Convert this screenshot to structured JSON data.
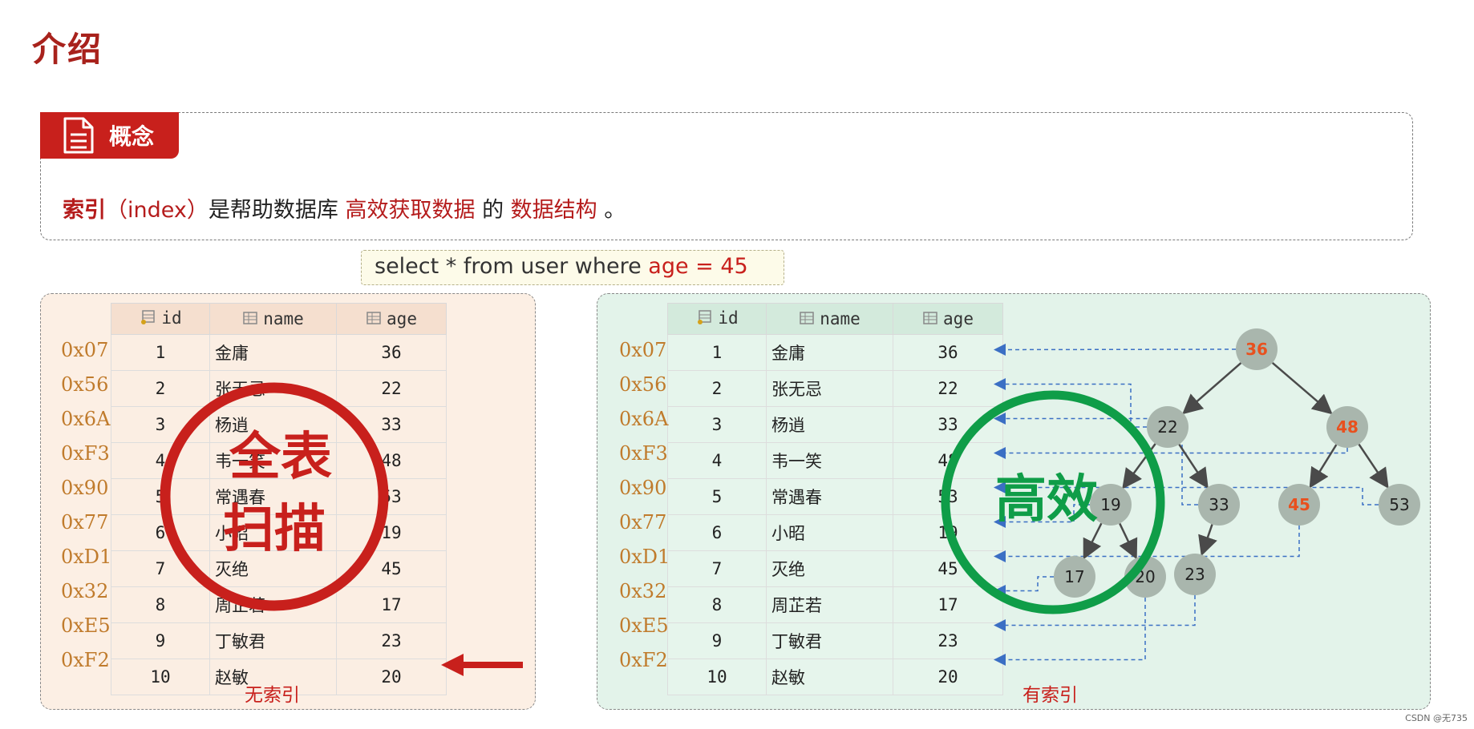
{
  "title": "介绍",
  "concept": {
    "tab_label": "概念",
    "text": {
      "term": "索引",
      "term_en": "（index）",
      "mid1": "是帮助数据库",
      "hl1": "高效获取数据",
      "mid2": "的",
      "hl2": "数据结构",
      "end": "。"
    }
  },
  "query": {
    "prefix": "select * from user where ",
    "highlight": "age = 45"
  },
  "columns": [
    "id",
    "name",
    "age"
  ],
  "rows": [
    {
      "addr": "0x07",
      "id": "1",
      "name": "金庸",
      "age": "36"
    },
    {
      "addr": "0x56",
      "id": "2",
      "name": "张无忌",
      "age": "22"
    },
    {
      "addr": "0x6A",
      "id": "3",
      "name": "杨逍",
      "age": "33"
    },
    {
      "addr": "0xF3",
      "id": "4",
      "name": "韦一笑",
      "age": "48"
    },
    {
      "addr": "0x90",
      "id": "5",
      "name": "常遇春",
      "age": "53"
    },
    {
      "addr": "0x77",
      "id": "6",
      "name": "小昭",
      "age": "19"
    },
    {
      "addr": "0xD1",
      "id": "7",
      "name": "灭绝",
      "age": "45"
    },
    {
      "addr": "0x32",
      "id": "8",
      "name": "周芷若",
      "age": "17"
    },
    {
      "addr": "0xE5",
      "id": "9",
      "name": "丁敏君",
      "age": "23"
    },
    {
      "addr": "0xF2",
      "id": "10",
      "name": "赵敏",
      "age": "20"
    }
  ],
  "left_panel": {
    "caption": "无索引",
    "stamp_line1": "全表",
    "stamp_line2": "扫描",
    "stamp_color": "#c8201c"
  },
  "right_panel": {
    "caption": "有索引",
    "stamp_text": "高效",
    "stamp_color": "#0f9d48"
  },
  "tree": {
    "nodes": [
      {
        "id": "n36",
        "label": "36",
        "highlight": true
      },
      {
        "id": "n22",
        "label": "22",
        "highlight": false
      },
      {
        "id": "n48",
        "label": "48",
        "highlight": true
      },
      {
        "id": "n19",
        "label": "19",
        "highlight": false
      },
      {
        "id": "n33",
        "label": "33",
        "highlight": false
      },
      {
        "id": "n45",
        "label": "45",
        "highlight": true
      },
      {
        "id": "n53",
        "label": "53",
        "highlight": false
      },
      {
        "id": "n17",
        "label": "17",
        "highlight": false
      },
      {
        "id": "n20",
        "label": "20",
        "highlight": false
      },
      {
        "id": "n23",
        "label": "23",
        "highlight": false
      }
    ],
    "edges": [
      [
        "n36",
        "n22"
      ],
      [
        "n36",
        "n48"
      ],
      [
        "n22",
        "n19"
      ],
      [
        "n22",
        "n33"
      ],
      [
        "n48",
        "n45"
      ],
      [
        "n48",
        "n53"
      ],
      [
        "n19",
        "n17"
      ],
      [
        "n19",
        "n20"
      ],
      [
        "n33",
        "n23"
      ]
    ],
    "pointers": [
      {
        "node": "n36",
        "row": 0
      },
      {
        "node": "n22",
        "row": 1
      },
      {
        "node": "n33",
        "row": 2
      },
      {
        "node": "n48",
        "row": 3
      },
      {
        "node": "n53",
        "row": 4
      },
      {
        "node": "n19",
        "row": 5
      },
      {
        "node": "n45",
        "row": 6
      },
      {
        "node": "n17",
        "row": 7
      },
      {
        "node": "n23",
        "row": 8
      },
      {
        "node": "n20",
        "row": 9
      }
    ],
    "highlight_color": "#e8501e",
    "node_color": "#a9b6ad"
  },
  "watermark": "CSDN @无735"
}
